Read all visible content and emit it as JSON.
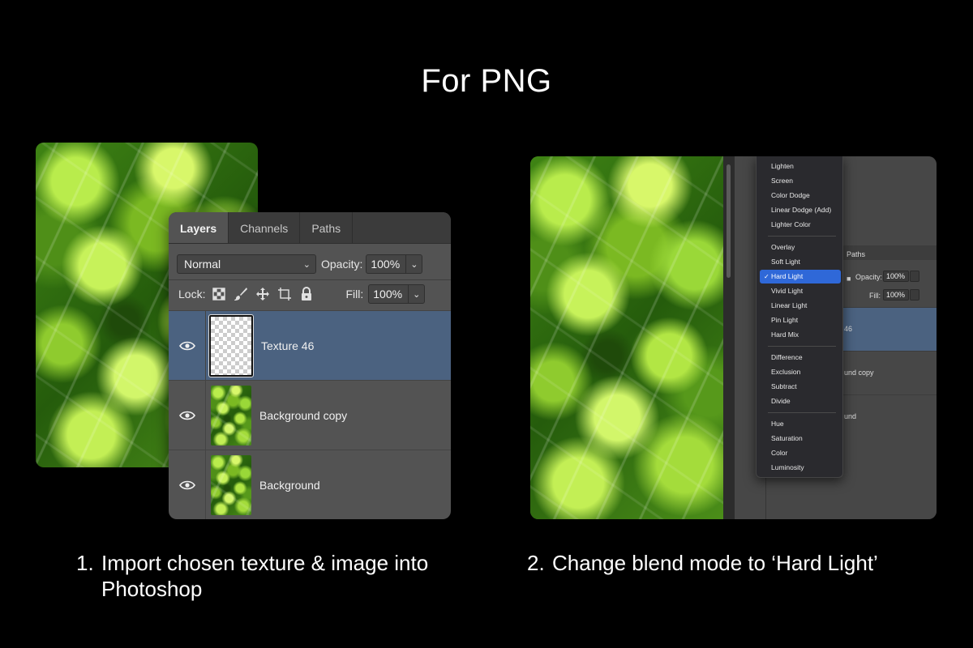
{
  "title": "For PNG",
  "layers_panel": {
    "tabs": [
      "Layers",
      "Channels",
      "Paths"
    ],
    "blend_mode": "Normal",
    "opacity_label": "Opacity:",
    "opacity_value": "100%",
    "lock_label": "Lock:",
    "fill_label": "Fill:",
    "fill_value": "100%",
    "layers": [
      {
        "name": "Texture 46",
        "selected": true
      },
      {
        "name": "Background copy",
        "selected": false
      },
      {
        "name": "Background",
        "selected": false
      }
    ]
  },
  "blend_menu": {
    "groups": [
      [
        "Lighten",
        "Screen",
        "Color Dodge",
        "Linear Dodge (Add)",
        "Lighter Color"
      ],
      [
        "Overlay",
        "Soft Light",
        "Hard Light",
        "Vivid Light",
        "Linear Light",
        "Pin Light",
        "Hard Mix"
      ],
      [
        "Difference",
        "Exclusion",
        "Subtract",
        "Divide"
      ],
      [
        "Hue",
        "Saturation",
        "Color",
        "Luminosity"
      ]
    ],
    "selected": "Hard Light",
    "check_mark": "✓",
    "bg_panel": {
      "tab": "Paths",
      "opacity_label": "Opacity:",
      "opacity_value": "100%",
      "fill_label": "Fill:",
      "fill_value": "100%",
      "layer_fragments": [
        "46",
        "und copy",
        "und"
      ]
    }
  },
  "steps": [
    {
      "number": "1.",
      "text_line1": "Import chosen texture & image into",
      "text_line2": "Photoshop"
    },
    {
      "number": "2.",
      "text_line1": "Change blend mode to ‘Hard Light’"
    }
  ],
  "colors": {
    "background": "#000000",
    "panel": "#535353",
    "selection": "#4b6280",
    "menu_highlight": "#2f68d8"
  }
}
